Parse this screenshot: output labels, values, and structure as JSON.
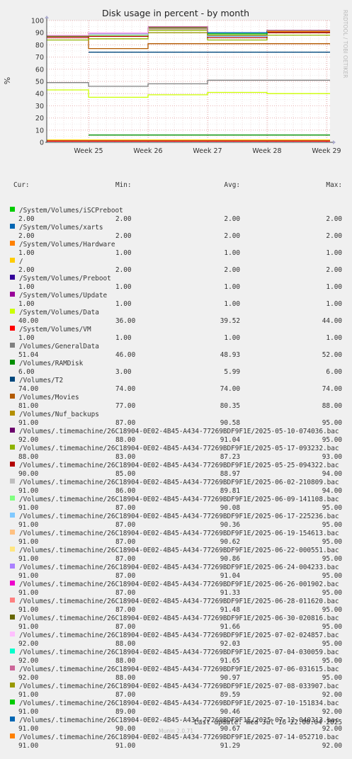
{
  "chart_data": {
    "type": "line",
    "title": "Disk usage in percent - by month",
    "ylabel": "%",
    "xlabel": "",
    "ylim": [
      0,
      100
    ],
    "yticks": [
      "0",
      "10",
      "20",
      "30",
      "40",
      "50",
      "60",
      "70",
      "80",
      "90",
      "100"
    ],
    "xticks": [
      "Week 25",
      "Week 26",
      "Week 27",
      "Week 28",
      "Week 29"
    ],
    "side_label": "RRDTOOL / TOBI OETIKER",
    "grid": true,
    "series": [
      {
        "name": "/System/Volumes/iSCPreboot",
        "color": "#00cc00",
        "cur": "2.00",
        "min": "2.00",
        "avg": "2.00",
        "max": "2.00",
        "values": [
          2,
          2,
          2,
          2,
          2
        ]
      },
      {
        "name": "/System/Volumes/xarts",
        "color": "#0066b3",
        "cur": "2.00",
        "min": "2.00",
        "avg": "2.00",
        "max": "2.00",
        "values": [
          2,
          2,
          2,
          2,
          2
        ]
      },
      {
        "name": "/System/Volumes/Hardware",
        "color": "#ff8000",
        "cur": "1.00",
        "min": "1.00",
        "avg": "1.00",
        "max": "1.00",
        "values": [
          1,
          1,
          1,
          1,
          1
        ]
      },
      {
        "name": "/",
        "color": "#ffcc00",
        "cur": "2.00",
        "min": "2.00",
        "avg": "2.00",
        "max": "2.00",
        "values": [
          2,
          2,
          2,
          2,
          2
        ]
      },
      {
        "name": "/System/Volumes/Preboot",
        "color": "#330099",
        "cur": "1.00",
        "min": "1.00",
        "avg": "1.00",
        "max": "1.00",
        "values": [
          1,
          1,
          1,
          1,
          1
        ]
      },
      {
        "name": "/System/Volumes/Update",
        "color": "#990099",
        "cur": "1.00",
        "min": "1.00",
        "avg": "1.00",
        "max": "1.00",
        "values": [
          1,
          1,
          1,
          1,
          1
        ]
      },
      {
        "name": "/System/Volumes/Data",
        "color": "#ccff00",
        "cur": "40.00",
        "min": "36.00",
        "avg": "39.52",
        "max": "44.00",
        "values": [
          43,
          37,
          39,
          41,
          40
        ]
      },
      {
        "name": "/System/Volumes/VM",
        "color": "#ff0000",
        "cur": "1.00",
        "min": "1.00",
        "avg": "1.00",
        "max": "1.00",
        "values": [
          1,
          1,
          1,
          1,
          1
        ]
      },
      {
        "name": "/Volumes/GeneralData",
        "color": "#808080",
        "cur": "51.04",
        "min": "46.00",
        "avg": "48.93",
        "max": "52.00",
        "values": [
          49,
          46,
          48,
          51,
          51
        ]
      },
      {
        "name": "/Volumes/RAMDisk",
        "color": "#008f00",
        "cur": "6.00",
        "min": "3.00",
        "avg": "5.99",
        "max": "6.00",
        "values": [
          null,
          6,
          6,
          6,
          6
        ]
      },
      {
        "name": "/Volumes/T2",
        "color": "#00487d",
        "cur": "74.00",
        "min": "74.00",
        "avg": "74.00",
        "max": "74.00",
        "values": [
          null,
          74,
          74,
          74,
          74
        ]
      },
      {
        "name": "/Volumes/Movies",
        "color": "#b35a00",
        "cur": "81.00",
        "min": "77.00",
        "avg": "80.35",
        "max": "88.00",
        "values": [
          87,
          77,
          81,
          81,
          81
        ]
      },
      {
        "name": "/Volumes/Nuf_backups",
        "color": "#b38f00",
        "cur": "91.00",
        "min": "87.00",
        "avg": "90.58",
        "max": "95.00",
        "values": [
          87,
          87,
          93,
          87,
          90
        ]
      },
      {
        "name": "/Volumes/.timemachine/26C18904-0E02-4B45-A434-77269BDF9F1E/2025-05-10-074036.bac",
        "color": "#6b006b",
        "cur": "92.00",
        "min": "88.00",
        "avg": "91.04",
        "max": "95.00",
        "values": [
          88,
          89,
          94,
          88,
          91
        ]
      },
      {
        "name": "/Volumes/.timemachine/26C18904-0E02-4B45-A434-77269BDF9F1E/2025-05-17-093232.bac",
        "color": "#8fb300",
        "cur": "88.00",
        "min": "83.00",
        "avg": "87.23",
        "max": "93.00",
        "values": [
          84,
          85,
          92,
          84,
          88
        ]
      },
      {
        "name": "/Volumes/.timemachine/26C18904-0E02-4B45-A434-77269BDF9F1E/2025-05-25-094322.bac",
        "color": "#b30000",
        "cur": "90.00",
        "min": "85.00",
        "avg": "88.97",
        "max": "94.00",
        "values": [
          86,
          87,
          93,
          86,
          90
        ]
      },
      {
        "name": "/Volumes/.timemachine/26C18904-0E02-4B45-A434-77269BDF9F1E/2025-06-02-210809.bac",
        "color": "#bebebe",
        "cur": "91.00",
        "min": "86.00",
        "avg": "89.81",
        "max": "94.00",
        "values": [
          87,
          88,
          93,
          87,
          91
        ]
      },
      {
        "name": "/Volumes/.timemachine/26C18904-0E02-4B45-A434-77269BDF9F1E/2025-06-09-141108.bac",
        "color": "#80ff80",
        "cur": "91.00",
        "min": "87.00",
        "avg": "90.08",
        "max": "95.00",
        "values": [
          87,
          88,
          94,
          87,
          91
        ]
      },
      {
        "name": "/Volumes/.timemachine/26C18904-0E02-4B45-A434-77269BDF9F1E/2025-06-17-225236.bac",
        "color": "#80c9ff",
        "cur": "91.00",
        "min": "87.00",
        "avg": "90.36",
        "max": "95.00",
        "values": [
          87,
          89,
          94,
          87,
          91
        ]
      },
      {
        "name": "/Volumes/.timemachine/26C18904-0E02-4B45-A434-77269BDF9F1E/2025-06-19-154613.bac",
        "color": "#ffc080",
        "cur": "91.00",
        "min": "87.00",
        "avg": "90.62",
        "max": "95.00",
        "values": [
          87,
          89,
          94,
          88,
          91
        ]
      },
      {
        "name": "/Volumes/.timemachine/26C18904-0E02-4B45-A434-77269BDF9F1E/2025-06-22-000551.bac",
        "color": "#ffe680",
        "cur": "91.00",
        "min": "87.00",
        "avg": "90.86",
        "max": "95.00",
        "values": [
          87,
          89,
          94,
          88,
          91
        ]
      },
      {
        "name": "/Volumes/.timemachine/26C18904-0E02-4B45-A434-77269BDF9F1E/2025-06-24-004233.bac",
        "color": "#aa80ff",
        "cur": "91.00",
        "min": "87.00",
        "avg": "91.04",
        "max": "95.00",
        "values": [
          87,
          89,
          94,
          88,
          91
        ]
      },
      {
        "name": "/Volumes/.timemachine/26C18904-0E02-4B45-A434-77269BDF9F1E/2025-06-26-001902.bac",
        "color": "#ee00cc",
        "cur": "91.00",
        "min": "87.00",
        "avg": "91.33",
        "max": "95.00",
        "values": [
          87,
          90,
          94,
          88,
          91
        ]
      },
      {
        "name": "/Volumes/.timemachine/26C18904-0E02-4B45-A434-77269BDF9F1E/2025-06-28-011620.bac",
        "color": "#ff8080",
        "cur": "91.00",
        "min": "87.00",
        "avg": "91.48",
        "max": "95.00",
        "values": [
          87,
          90,
          94,
          89,
          91
        ]
      },
      {
        "name": "/Volumes/.timemachine/26C18904-0E02-4B45-A434-77269BDF9F1E/2025-06-30-020816.bac",
        "color": "#666600",
        "cur": "91.00",
        "min": "87.00",
        "avg": "91.66",
        "max": "95.00",
        "values": [
          87,
          90,
          94,
          89,
          91
        ]
      },
      {
        "name": "/Volumes/.timemachine/26C18904-0E02-4B45-A434-77269BDF9F1E/2025-07-02-024857.bac",
        "color": "#ffbfff",
        "cur": "92.00",
        "min": "88.00",
        "avg": "92.03",
        "max": "95.00",
        "values": [
          88,
          90,
          95,
          89,
          92
        ]
      },
      {
        "name": "/Volumes/.timemachine/26C18904-0E02-4B45-A434-77269BDF9F1E/2025-07-04-030059.bac",
        "color": "#00ffcc",
        "cur": "92.00",
        "min": "88.00",
        "avg": "91.65",
        "max": "95.00",
        "values": [
          null,
          null,
          95,
          89,
          92
        ]
      },
      {
        "name": "/Volumes/.timemachine/26C18904-0E02-4B45-A434-77269BDF9F1E/2025-07-06-031615.bac",
        "color": "#cc6699",
        "cur": "92.00",
        "min": "88.00",
        "avg": "90.97",
        "max": "95.00",
        "values": [
          null,
          null,
          95,
          89,
          92
        ]
      },
      {
        "name": "/Volumes/.timemachine/26C18904-0E02-4B45-A434-77269BDF9F1E/2025-07-08-033907.bac",
        "color": "#999900",
        "cur": "91.00",
        "min": "87.00",
        "avg": "89.59",
        "max": "92.00",
        "values": [
          null,
          null,
          90,
          88,
          91
        ]
      },
      {
        "name": "/Volumes/.timemachine/26C18904-0E02-4B45-A434-77269BDF9F1E/2025-07-10-151834.bac",
        "color": "#00cc00",
        "cur": "91.00",
        "min": "89.00",
        "avg": "90.46",
        "max": "92.00",
        "values": [
          null,
          null,
          null,
          89,
          91
        ]
      },
      {
        "name": "/Volumes/.timemachine/26C18904-0E02-4B45-A434-77269BDF9F1E/2025-07-12-040313.bac",
        "color": "#0066b3",
        "cur": "91.00",
        "min": "90.00",
        "avg": "90.67",
        "max": "92.00",
        "values": [
          null,
          null,
          null,
          90,
          91
        ]
      },
      {
        "name": "/Volumes/.timemachine/26C18904-0E02-4B45-A434-77269BDF9F1E/2025-07-14-052710.bac",
        "color": "#ff8000",
        "cur": "91.00",
        "min": "91.00",
        "avg": "91.29",
        "max": "92.00",
        "values": [
          null,
          null,
          null,
          null,
          91
        ]
      }
    ]
  },
  "legend_header": {
    "cur": "Cur:",
    "min": "Min:",
    "avg": "Avg:",
    "max": "Max:"
  },
  "last_update": "Last update: Wed Jul 16 22:00:04 2025",
  "footer": "Munin 2.0.71"
}
